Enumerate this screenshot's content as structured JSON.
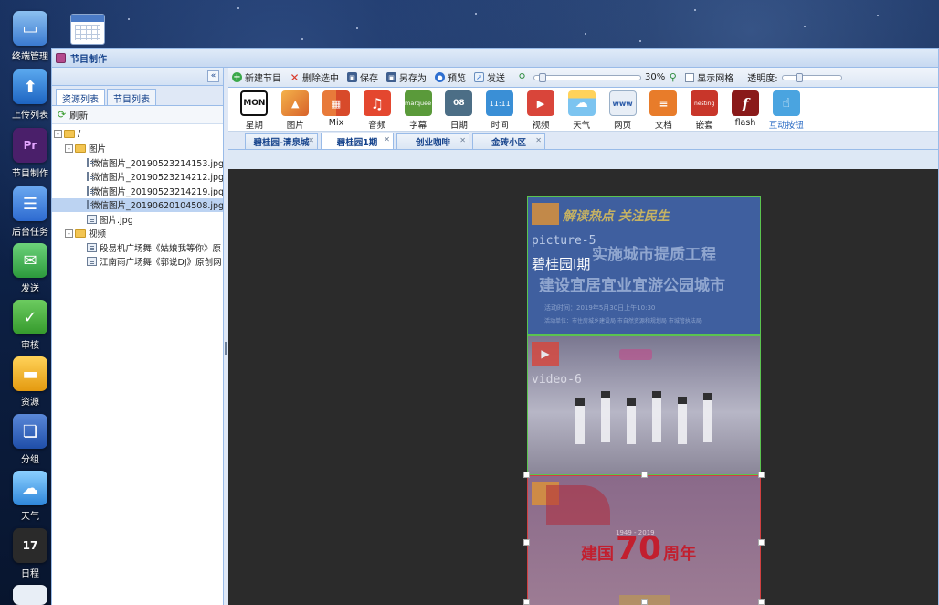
{
  "dock": {
    "items": [
      {
        "label": "终端管理",
        "icon": "monitor-icon",
        "color": "#4a90d9"
      },
      {
        "label": "上传列表",
        "icon": "upload-arrow-icon",
        "color": "#2f7fd6"
      },
      {
        "label": "节目制作",
        "icon": "premiere-icon",
        "color": "#5a2a7a"
      },
      {
        "label": "后台任务",
        "icon": "task-list-icon",
        "color": "#3a78d8"
      },
      {
        "label": "发送",
        "icon": "send-icon",
        "color": "#3aa84a"
      },
      {
        "label": "审核",
        "icon": "check-icon",
        "color": "#45a93f"
      },
      {
        "label": "资源",
        "icon": "folder-icon",
        "color": "#e8a21c"
      },
      {
        "label": "分组",
        "icon": "group-icon",
        "color": "#2d5fb8"
      },
      {
        "label": "天气",
        "icon": "weather-icon",
        "color": "#3b8fe0"
      },
      {
        "label": "日程",
        "icon": "calendar-icon",
        "color": "#2a2a2a",
        "text": "17"
      }
    ]
  },
  "window": {
    "title": "节目制作"
  },
  "left": {
    "tabs": [
      "资源列表",
      "节目列表"
    ],
    "refresh": "刷新",
    "collapse": "«",
    "tree": [
      {
        "label": "/",
        "type": "folder",
        "indent": 0,
        "toggle": "-"
      },
      {
        "label": "图片",
        "type": "folder",
        "indent": 1,
        "toggle": "-"
      },
      {
        "label": "微信图片_20190523214153.jpg",
        "type": "file",
        "indent": 2
      },
      {
        "label": "微信图片_20190523214212.jpg",
        "type": "file",
        "indent": 2
      },
      {
        "label": "微信图片_20190523214219.jpg",
        "type": "file",
        "indent": 2
      },
      {
        "label": "微信图片_20190620104508.jpg",
        "type": "file",
        "indent": 2,
        "selected": true
      },
      {
        "label": "图片.jpg",
        "type": "file",
        "indent": 2
      },
      {
        "label": "视频",
        "type": "folder",
        "indent": 1,
        "toggle": "-"
      },
      {
        "label": "段易机广场舞《姑娘我等你》原",
        "type": "file",
        "indent": 2
      },
      {
        "label": "江南雨广场舞《郭说DJ》原创网",
        "type": "file",
        "indent": 2
      }
    ]
  },
  "toolbar": {
    "new": "新建节目",
    "delete": "删除选中",
    "save": "保存",
    "save_as": "另存为",
    "preview": "预览",
    "send": "发送",
    "zoom": "30%",
    "zoom_fraction": 0.05,
    "grid": "显示网格",
    "opacity": "透明度:",
    "opacity_fraction": 0.25
  },
  "icons": [
    {
      "label": "星期",
      "icon": "weekday-icon",
      "text": "MON",
      "color": "#111111"
    },
    {
      "label": "图片",
      "icon": "picture-icon",
      "color": "#e8953a"
    },
    {
      "label": "Mix",
      "icon": "mix-icon",
      "color": "#d9643a"
    },
    {
      "label": "音频",
      "icon": "music-icon",
      "text": "♫",
      "color": "#e4472f"
    },
    {
      "label": "字幕",
      "icon": "marquee-icon",
      "text": "marquee",
      "color": "#5a9a3a"
    },
    {
      "label": "日期",
      "icon": "date-icon",
      "text": "08",
      "color": "#4c6e86"
    },
    {
      "label": "时间",
      "icon": "clock-icon",
      "text": "11:11",
      "color": "#3a8fd6"
    },
    {
      "label": "视频",
      "icon": "video-icon",
      "text": "▶",
      "color": "#d9453a"
    },
    {
      "label": "天气",
      "icon": "weather-icon",
      "color": "#4aa4e0"
    },
    {
      "label": "网页",
      "icon": "webpage-icon",
      "text": "www",
      "color": "#9ab0c8"
    },
    {
      "label": "文档",
      "icon": "document-icon",
      "color": "#e87c2a"
    },
    {
      "label": "嵌套",
      "icon": "nested-icon",
      "text": "nesting",
      "color": "#c8362a"
    },
    {
      "label": "flash",
      "icon": "flash-icon",
      "text": "f",
      "color": "#8a1a1a"
    },
    {
      "label": "互动按钮",
      "icon": "touch-icon",
      "color": "#4aa4e0",
      "blue": true
    }
  ],
  "program_tabs": [
    {
      "label": "碧桂园-清泉城",
      "active": false
    },
    {
      "label": "碧桂园1期",
      "active": true
    },
    {
      "label": "创业咖啡",
      "active": false
    },
    {
      "label": "金砖小区",
      "active": false
    }
  ],
  "canvas": {
    "pic1": {
      "name": "picture-5",
      "label": "碧桂园I期",
      "headline": "解读热点 关注民生",
      "line1": "实施城市提质工程",
      "line2": "建设宜居宜业宜游公园城市",
      "info1": "活动时间：2019年5月30日上午10:30",
      "info2": "活动单位：市住房城乡建设局  市自然资源和规划局  市城管执法局"
    },
    "video": {
      "name": "video-6"
    },
    "pic2": {
      "years": "1949 - 2019",
      "title_a": "建国",
      "title_num": "70",
      "title_b": "周年"
    }
  }
}
